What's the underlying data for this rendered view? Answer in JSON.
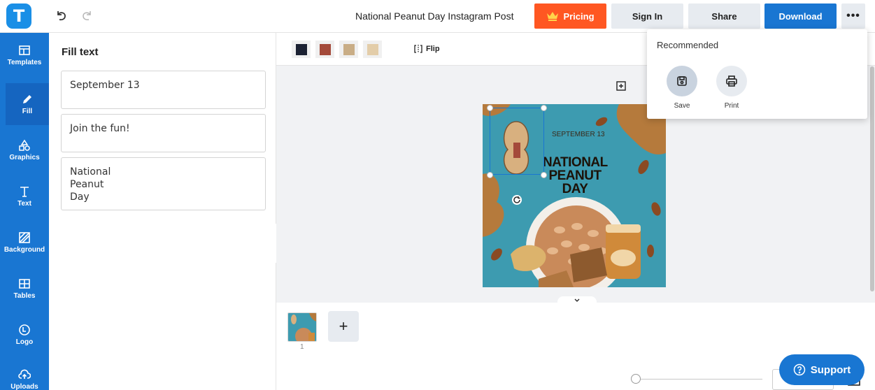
{
  "header": {
    "title": "National Peanut Day Instagram Post",
    "pricing_label": "Pricing",
    "signin_label": "Sign In",
    "share_label": "Share",
    "download_label": "Download",
    "more_label": "•••",
    "logo_letter": "T"
  },
  "sidebar": {
    "items": [
      {
        "label": "Templates",
        "icon": "templates-icon"
      },
      {
        "label": "Fill",
        "icon": "pencil-icon"
      },
      {
        "label": "Graphics",
        "icon": "shapes-icon"
      },
      {
        "label": "Text",
        "icon": "text-icon"
      },
      {
        "label": "Background",
        "icon": "background-icon"
      },
      {
        "label": "Tables",
        "icon": "table-icon"
      },
      {
        "label": "Logo",
        "icon": "logo-icon"
      },
      {
        "label": "Uploads",
        "icon": "upload-icon"
      }
    ],
    "active": "Fill"
  },
  "fill_panel": {
    "title": "Fill text",
    "fields": [
      "September 13",
      "Join the fun!",
      "National\nPeanut\nDay"
    ]
  },
  "toolbar": {
    "swatches": [
      "#1c2233",
      "#a44a3a",
      "#c9ad86",
      "#e3cda9"
    ],
    "flip_label": "Flip"
  },
  "artwork": {
    "date_text": "SEPTEMBER 13",
    "title_text": "NATIONAL\nPEANUT\nDAY",
    "colors": {
      "background": "#3d9bb0",
      "splash": "#b57a3c",
      "peanut": "#d8b07f"
    }
  },
  "pages": {
    "page_number": "1",
    "add_label": "+"
  },
  "dropdown": {
    "title": "Recommended",
    "items": [
      {
        "label": "Save",
        "icon": "save-icon"
      },
      {
        "label": "Print",
        "icon": "print-icon"
      }
    ]
  },
  "support_label": "Support",
  "colors": {
    "primary": "#1976d2",
    "pricing": "#ff5722",
    "secondary_button": "#e7ebf0"
  }
}
